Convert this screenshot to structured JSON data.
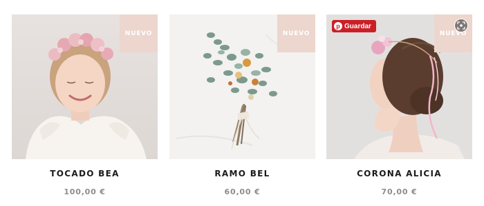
{
  "products": [
    {
      "name": "TOCADO BEA",
      "price": "100,00 €",
      "badge": "NUEVO"
    },
    {
      "name": "RAMO BEL",
      "price": "60,00 €",
      "badge": "NUEVO"
    },
    {
      "name": "CORONA ALICIA",
      "price": "70,00 €",
      "badge": "NUEVO"
    }
  ],
  "overlay": {
    "save_label": "Guardar",
    "save_logo": "p",
    "save_icon": "pinterest-icon",
    "lens_icon": "visual-search-icon"
  },
  "colors": {
    "badge_bg": "#ecd6cd",
    "save_button_bg": "#cb1f27",
    "title_text": "#1a1a1a",
    "price_text": "#8c8c8c"
  }
}
